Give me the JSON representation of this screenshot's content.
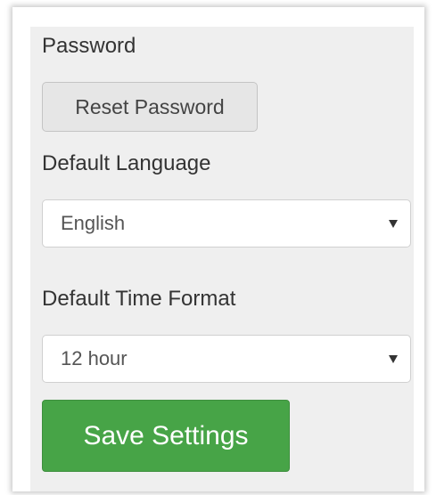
{
  "password": {
    "label": "Password",
    "reset_button_label": "Reset Password"
  },
  "language": {
    "label": "Default Language",
    "selected": "English"
  },
  "time_format": {
    "label": "Default Time Format",
    "selected": "12 hour"
  },
  "save_button_label": "Save Settings",
  "colors": {
    "panel_background": "#efefef",
    "save_button": "#47a447",
    "reset_button": "#e6e6e6",
    "text": "#333333"
  },
  "icons": {
    "dropdown": "caret-down-icon"
  }
}
